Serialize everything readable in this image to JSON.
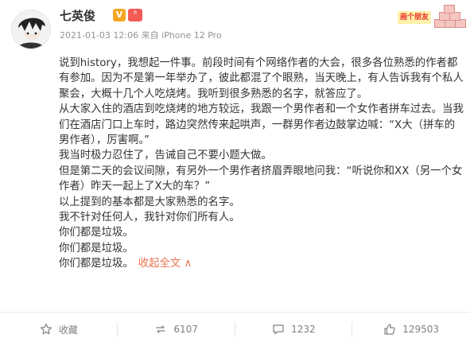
{
  "post": {
    "username": "七英俊",
    "verified_badge": "V",
    "rank_badge": "⁶",
    "meta": "2021-01-03 12:06 来自 iPhone 12 Pro",
    "corner_tag": "画个朋友",
    "paragraphs": [
      "说到history，我想起一件事。前段时间有个网络作者的大会，很多各位熟悉的作者都有参加。因为不是第一年举办了，彼此都混了个眼熟，当天晚上，有人告诉我有个私人聚会，大概十几个人吃烧烤。我听到很多熟悉的名字，就答应了。",
      "从大家入住的酒店到吃烧烤的地方较远，我跟一个男作者和一个女作者拼车过去。当我们在酒店门口上车时，路边突然传来起哄声，一群男作者边鼓掌边喊：“X大（拼车的男作者），厉害啊。”",
      "我当时极力忍住了，告诫自己不要小题大做。",
      "但是第二天的会议间隙，有另外一个男作者挤眉弄眼地问我：“听说你和XX（另一个女作者）昨天一起上了X大的车？”",
      "以上提到的基本都是大家熟悉的名字。",
      "我不针对任何人，我针对你们所有人。",
      "你们都是垃圾。",
      "你们都是垃圾。",
      "你们都是垃圾。"
    ],
    "collapse_label": "收起全文 ∧"
  },
  "actions": [
    {
      "name": "favorite",
      "icon": "star-icon",
      "label": "收藏"
    },
    {
      "name": "repost",
      "icon": "repost-icon",
      "label": "6107"
    },
    {
      "name": "comment",
      "icon": "comment-icon",
      "label": "1232"
    },
    {
      "name": "like",
      "icon": "thumbs-up-icon",
      "label": "129503"
    }
  ],
  "colors": {
    "link": "#eb7350",
    "meta": "#939393",
    "action": "#808080"
  }
}
